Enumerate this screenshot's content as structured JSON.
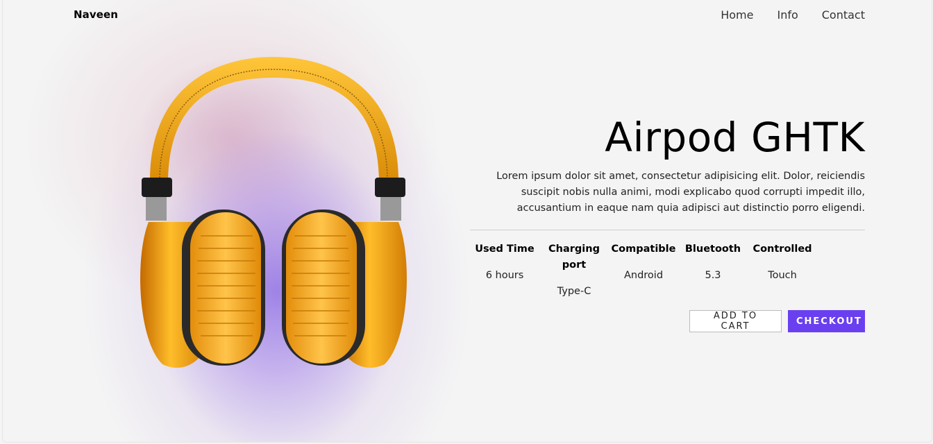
{
  "header": {
    "brand": "Naveen",
    "nav": [
      "Home",
      "Info",
      "Contact"
    ]
  },
  "product": {
    "title": "Airpod GHTK",
    "description": "Lorem ipsum dolor sit amet, consectetur adipisicing elit. Dolor, reiciendis suscipit nobis nulla animi, modi explicabo quod corrupti impedit illo, accusantium in eaque nam quia adipisci aut distinctio porro eligendi.",
    "image_icon": "headphones-image",
    "specs": [
      {
        "label": "Used Time",
        "value": "6 hours"
      },
      {
        "label": "Charging port",
        "value": "Type-C"
      },
      {
        "label": "Compatible",
        "value": "Android"
      },
      {
        "label": "Bluetooth",
        "value": "5.3"
      },
      {
        "label": "Controlled",
        "value": "Touch"
      }
    ]
  },
  "actions": {
    "add_to_cart": "ADD TO CART",
    "checkout": "CHECKOUT"
  },
  "colors": {
    "accent": "#6a3ff0",
    "product": "#f2a81a",
    "background": "#f4f4f4"
  }
}
